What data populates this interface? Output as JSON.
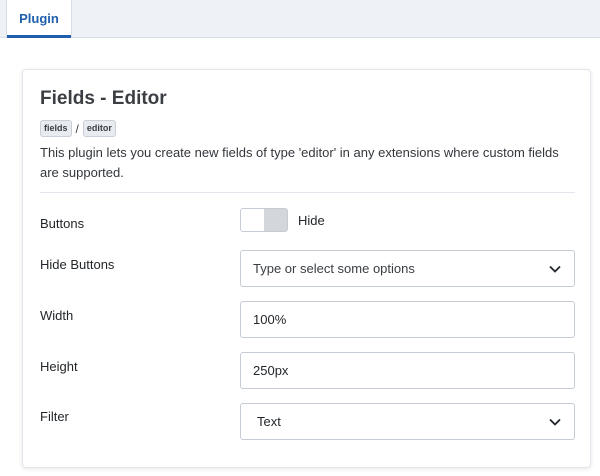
{
  "tabs": [
    {
      "label": "Plugin",
      "active": true
    }
  ],
  "plugin": {
    "title": "Fields - Editor",
    "tags": [
      "fields",
      "editor"
    ],
    "tag_separator": "/",
    "description": "This plugin lets you create new fields of type 'editor' in any extensions where custom fields are supported."
  },
  "form": {
    "buttons": {
      "label": "Buttons",
      "toggle_state": "Hide"
    },
    "hide_buttons": {
      "label": "Hide Buttons",
      "placeholder": "Type or select some options"
    },
    "width": {
      "label": "Width",
      "value": "100%"
    },
    "height": {
      "label": "Height",
      "value": "250px"
    },
    "filter": {
      "label": "Filter",
      "selected": "Text"
    }
  },
  "colors": {
    "accent": "#1f5fad",
    "background": "#eef2f7",
    "border": "#c6ccd4"
  },
  "icons": {
    "select_chevron": "chevron-down-icon"
  }
}
